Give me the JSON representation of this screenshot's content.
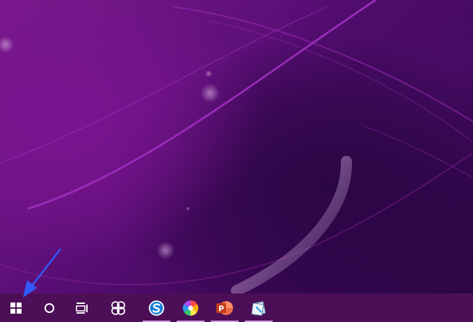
{
  "desktop": {
    "wallpaper_name": "purple-abstract-wallpaper",
    "colors": {
      "base": "#5c0f78",
      "glow": "#8c1fa8",
      "dark": "#2e0546"
    }
  },
  "taskbar": {
    "background": "#4c0f57",
    "indicator_color": "#d59ae0",
    "system_items": [
      {
        "name": "start-button",
        "icon": "windows-logo-icon"
      },
      {
        "name": "cortana-search-button",
        "icon": "circle-search-icon"
      },
      {
        "name": "task-view-button",
        "icon": "task-view-icon"
      }
    ],
    "pinned_apps": [
      {
        "name": "pinwheel-app",
        "icon": "pinwheel-icon",
        "running": false
      },
      {
        "name": "sogou-browser",
        "icon": "s-logo-icon",
        "running": true,
        "color": "#1a7fd6"
      },
      {
        "name": "photo-app",
        "icon": "color-wheel-icon",
        "running": true
      },
      {
        "name": "powerpoint",
        "icon": "powerpoint-icon",
        "running": true,
        "color": "#d24726",
        "letter": "P"
      },
      {
        "name": "notes-app",
        "icon": "notebook-icon",
        "running": true
      }
    ]
  },
  "annotation": {
    "type": "arrow",
    "color": "#2f5bff",
    "points_to": "start-button"
  }
}
